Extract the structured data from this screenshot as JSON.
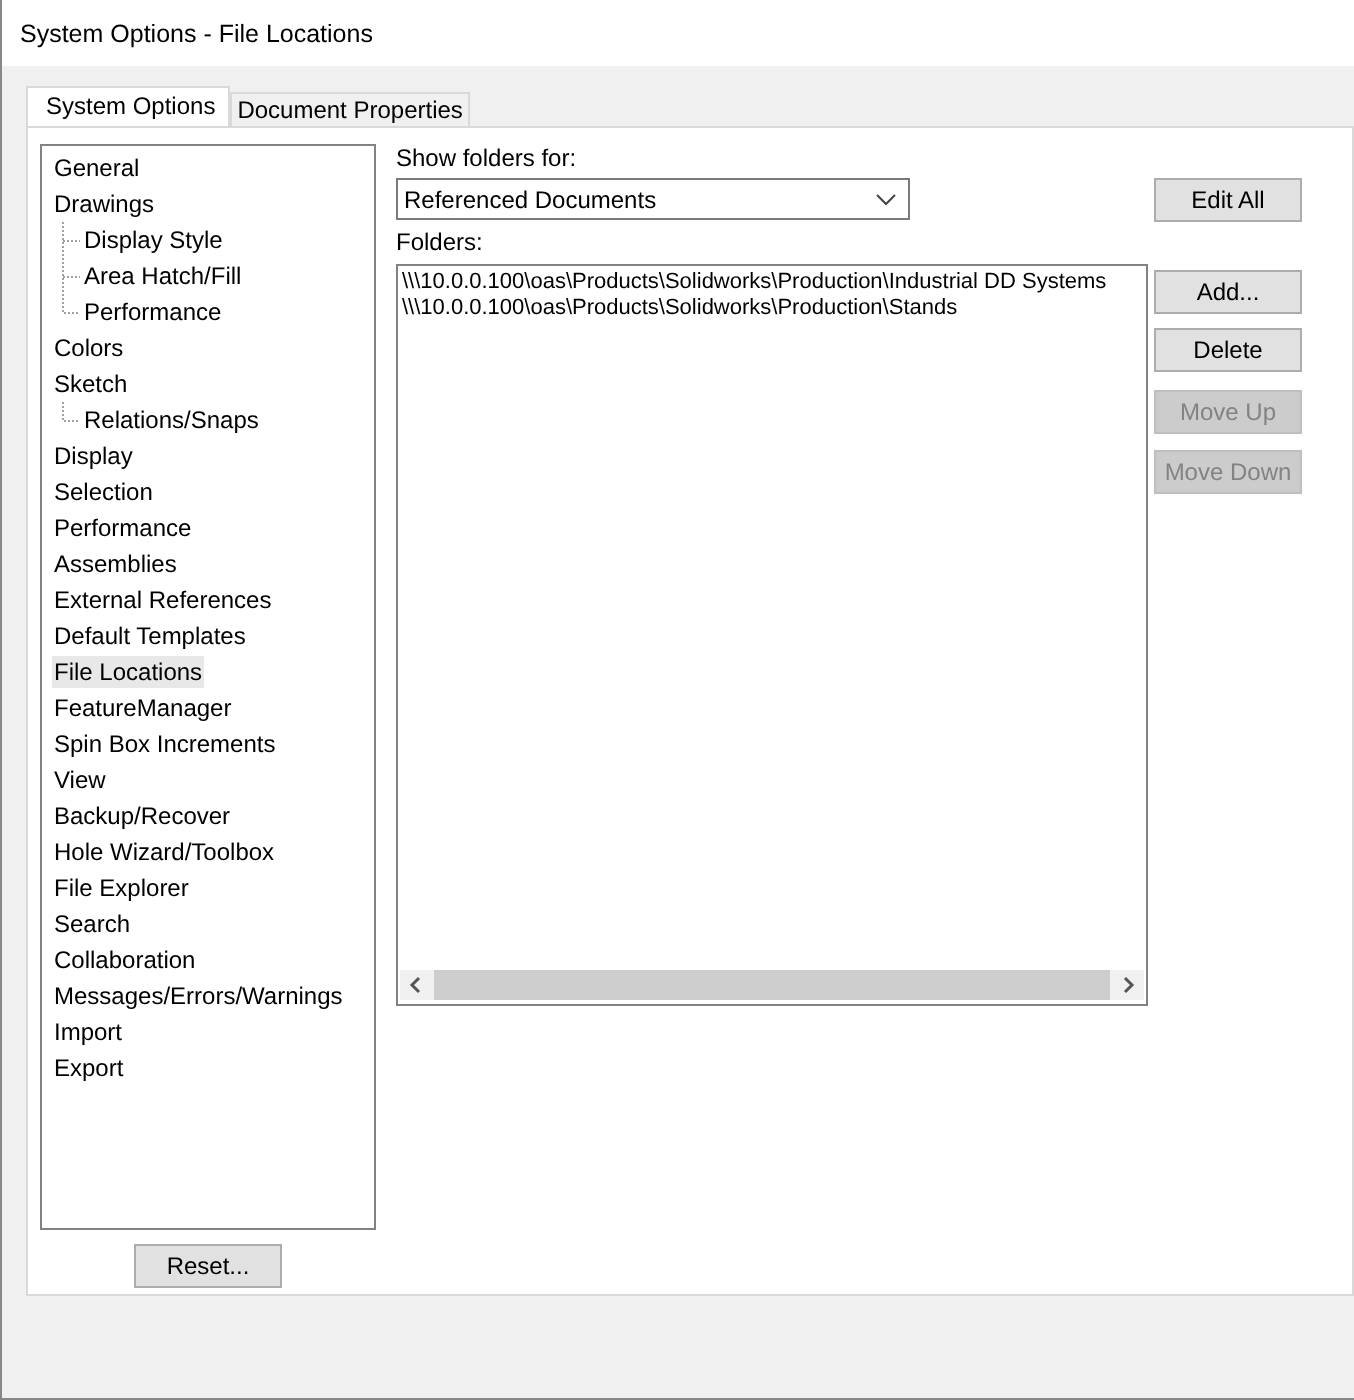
{
  "window": {
    "title": "System Options - File Locations"
  },
  "tabs": [
    {
      "label": "System Options",
      "selected": true
    },
    {
      "label": "Document Properties",
      "selected": false
    }
  ],
  "tree": [
    {
      "label": "General",
      "selected": false
    },
    {
      "label": "Drawings",
      "selected": false,
      "children": [
        {
          "label": "Display Style",
          "selected": false
        },
        {
          "label": "Area Hatch/Fill",
          "selected": false
        },
        {
          "label": "Performance",
          "selected": false
        }
      ]
    },
    {
      "label": "Colors",
      "selected": false
    },
    {
      "label": "Sketch",
      "selected": false,
      "children": [
        {
          "label": "Relations/Snaps",
          "selected": false
        }
      ]
    },
    {
      "label": "Display",
      "selected": false
    },
    {
      "label": "Selection",
      "selected": false
    },
    {
      "label": "Performance",
      "selected": false
    },
    {
      "label": "Assemblies",
      "selected": false
    },
    {
      "label": "External References",
      "selected": false
    },
    {
      "label": "Default Templates",
      "selected": false
    },
    {
      "label": "File Locations",
      "selected": true
    },
    {
      "label": "FeatureManager",
      "selected": false
    },
    {
      "label": "Spin Box Increments",
      "selected": false
    },
    {
      "label": "View",
      "selected": false
    },
    {
      "label": "Backup/Recover",
      "selected": false
    },
    {
      "label": "Hole Wizard/Toolbox",
      "selected": false
    },
    {
      "label": "File Explorer",
      "selected": false
    },
    {
      "label": "Search",
      "selected": false
    },
    {
      "label": "Collaboration",
      "selected": false
    },
    {
      "label": "Messages/Errors/Warnings",
      "selected": false
    },
    {
      "label": "Import",
      "selected": false
    },
    {
      "label": "Export",
      "selected": false
    }
  ],
  "reset_button": "Reset...",
  "show_folders_label": "Show folders for:",
  "show_folders_dropdown": {
    "value": "Referenced Documents"
  },
  "folders_label": "Folders:",
  "folders": [
    "\\\\\\10.0.0.100\\oas\\Products\\Solidworks\\Production\\Industrial DD Systems",
    "\\\\\\10.0.0.100\\oas\\Products\\Solidworks\\Production\\Stands"
  ],
  "side_buttons": [
    {
      "label": "Edit All",
      "disabled": false
    },
    {
      "label": "Add...",
      "disabled": false
    },
    {
      "label": "Delete",
      "disabled": false
    },
    {
      "label": "Move Up",
      "disabled": true
    },
    {
      "label": "Move Down",
      "disabled": true
    }
  ]
}
